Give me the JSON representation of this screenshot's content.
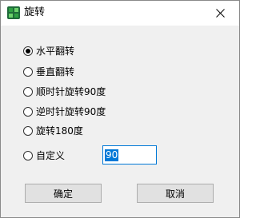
{
  "window": {
    "title": "旋转",
    "close_label": "✕"
  },
  "rotation_options": [
    {
      "label": "水平翻转",
      "checked": true
    },
    {
      "label": "垂直翻转",
      "checked": false
    },
    {
      "label": "顺时针旋转90度",
      "checked": false
    },
    {
      "label": "逆时针旋转90度",
      "checked": false
    },
    {
      "label": "旋转180度",
      "checked": false
    },
    {
      "label": "自定义",
      "checked": false
    }
  ],
  "custom_angle": {
    "value": "90"
  },
  "buttons": {
    "ok_label": "确定",
    "cancel_label": "取消"
  },
  "colors": {
    "accent": "#0078d7",
    "dialog_bg": "#f0f0f0",
    "button_bg": "#e1e1e1",
    "app_icon": "#1f6b3a"
  },
  "icons": {
    "app": "app-icon",
    "close": "close-icon"
  }
}
